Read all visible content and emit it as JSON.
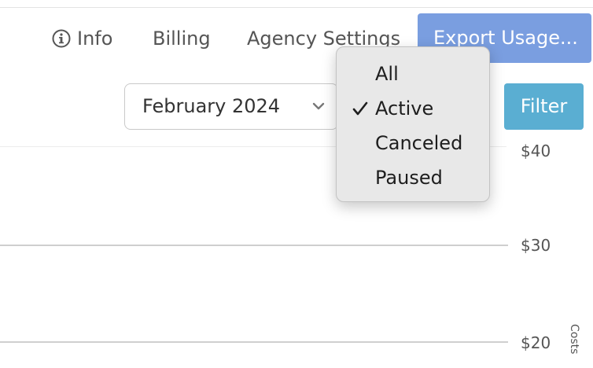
{
  "nav": {
    "info_label": "Info",
    "billing_label": "Billing",
    "agency_settings_label": "Agency Settings",
    "export_label": "Export Usage..."
  },
  "filters": {
    "month_value": "February 2024",
    "filter_label": "Filter",
    "status_options": [
      "All",
      "Active",
      "Canceled",
      "Paused"
    ],
    "status_selected": "Active"
  },
  "chart": {
    "y_ticks": [
      "$40",
      "$30",
      "$20"
    ],
    "y_axis_label": "Costs"
  },
  "colors": {
    "export_button": "#7a9ee0",
    "filter_button": "#5aaed2",
    "select_accent": "#2f63c9"
  },
  "icons": [
    "info-circle-icon",
    "chevron-down-icon",
    "checkmark-icon"
  ]
}
